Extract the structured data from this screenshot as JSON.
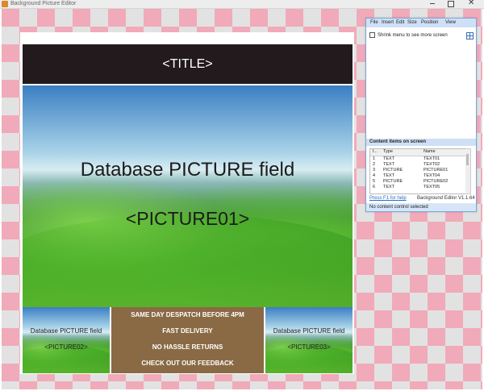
{
  "window": {
    "title": "Background Picture Editor",
    "close_glyph": "✕"
  },
  "board": {
    "title_placeholder": "<TITLE>",
    "main_picture": {
      "caption": "Database PICTURE field",
      "field": "<PICTURE01>"
    },
    "picture_left": {
      "caption": "Database PICTURE field",
      "field": "<PICTURE02>"
    },
    "picture_right": {
      "caption": "Database PICTURE field",
      "field": "<PICTURE03>"
    },
    "promo_lines": [
      "SAME DAY DESPATCH BEFORE 4PM",
      "FAST DELIVERY",
      "NO HASSLE RETURNS",
      "CHECK OUT OUR FEEDBACK"
    ]
  },
  "panel": {
    "menu": [
      "File",
      "Insert",
      "Edit",
      "Size",
      "Position",
      "View"
    ],
    "shrink_label": "Shrink menu to see more screen",
    "section_title": "Content items on screen",
    "columns": [
      "I...",
      "Type",
      "Name"
    ],
    "rows": [
      {
        "i": "1",
        "type": "TEXT",
        "name": "TEXT01"
      },
      {
        "i": "2",
        "type": "TEXT",
        "name": "TEXT02"
      },
      {
        "i": "3",
        "type": "PICTURE",
        "name": "PICTURE01"
      },
      {
        "i": "4",
        "type": "TEXT",
        "name": "TEXT04"
      },
      {
        "i": "5",
        "type": "PICTURE",
        "name": "PICTURE02"
      },
      {
        "i": "6",
        "type": "TEXT",
        "name": "TEXT05"
      }
    ],
    "help_link": "Press F1 for help",
    "version": "Background Editor V1.1.64",
    "status": "No content control selected"
  },
  "colors": {
    "checker_pink": "#f1aab9",
    "checker_grey": "#e2e2e2",
    "header_bg": "#221a1d",
    "promo_bg": "#8a6a45",
    "panel_accent": "#cfe0f6"
  }
}
